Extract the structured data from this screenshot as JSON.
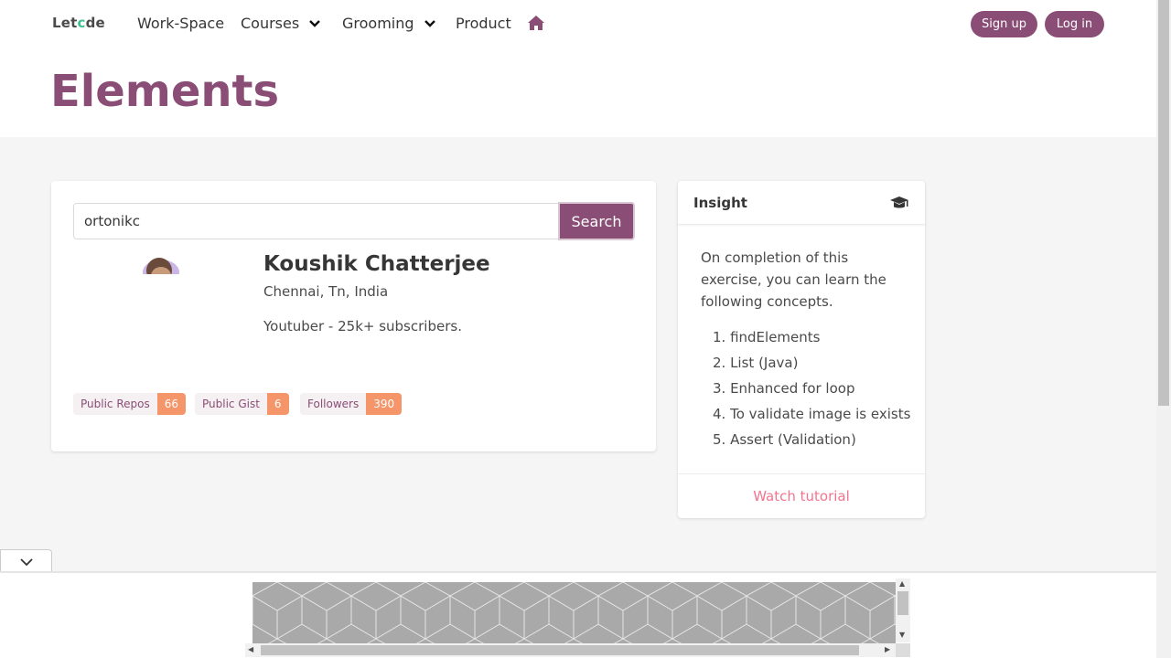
{
  "nav": {
    "brand_pre": "Let",
    "brand_o": "c",
    "brand_post": "de",
    "brand_full": "Letcode",
    "items": [
      "Work-Space",
      "Courses",
      "Grooming",
      "Product"
    ],
    "signup": "Sign up",
    "login": "Log in",
    "home_icon": "home-icon"
  },
  "hero": {
    "title": "Elements"
  },
  "search": {
    "value": "ortonikc",
    "button": "Search"
  },
  "profile": {
    "name": "Koushik Chatterjee",
    "location": "Chennai, Tn, India",
    "bio": "Youtuber - 25k+ subscribers."
  },
  "tags": [
    {
      "label": "Public Repos",
      "count": "66"
    },
    {
      "label": "Public Gist",
      "count": "6"
    },
    {
      "label": "Followers",
      "count": "390"
    }
  ],
  "insight": {
    "title": "Insight",
    "icon": "graduation-cap-icon",
    "intro": "On completion of this exercise, you can learn the following concepts.",
    "concepts": [
      "1. findElements",
      "2. List (Java)",
      "3. Enhanced for loop",
      "4. To validate image is exists",
      "5. Assert (Validation)"
    ],
    "footer_link": "Watch tutorial"
  },
  "colors": {
    "primary": "#8a4d76",
    "tag_count": "#f4956a",
    "link": "#f14668",
    "brand_o": "#3ec18f"
  }
}
